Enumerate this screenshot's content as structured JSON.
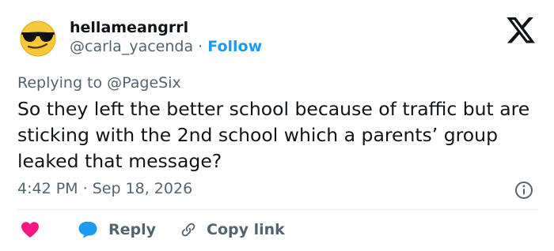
{
  "user": {
    "display_name": "hellameangrrl",
    "handle": "@carla_yacenda",
    "separator": "·",
    "follow_label": "Follow",
    "avatar_icon": "sunglasses-emoji-icon"
  },
  "platform_icon": "x-logo-icon",
  "reply_context": {
    "prefix": "Replying to",
    "mention": "@PageSix"
  },
  "tweet": {
    "text": "So they left the better school because of traffic but are sticking with the 2nd school which a parents’ group leaked that message?",
    "time": "4:42 PM",
    "separator": "·",
    "date": "Sep 18, 2026"
  },
  "actions": {
    "like_icon": "heart-icon",
    "reply_label": "Reply",
    "reply_icon": "speech-bubble-icon",
    "copy_label": "Copy link",
    "copy_icon": "link-icon",
    "info_icon": "info-icon"
  },
  "colors": {
    "accent": "#1d9bf0",
    "like": "#f91880",
    "text": "#0f1419",
    "muted": "#536471",
    "divider": "#e6ecf0"
  }
}
